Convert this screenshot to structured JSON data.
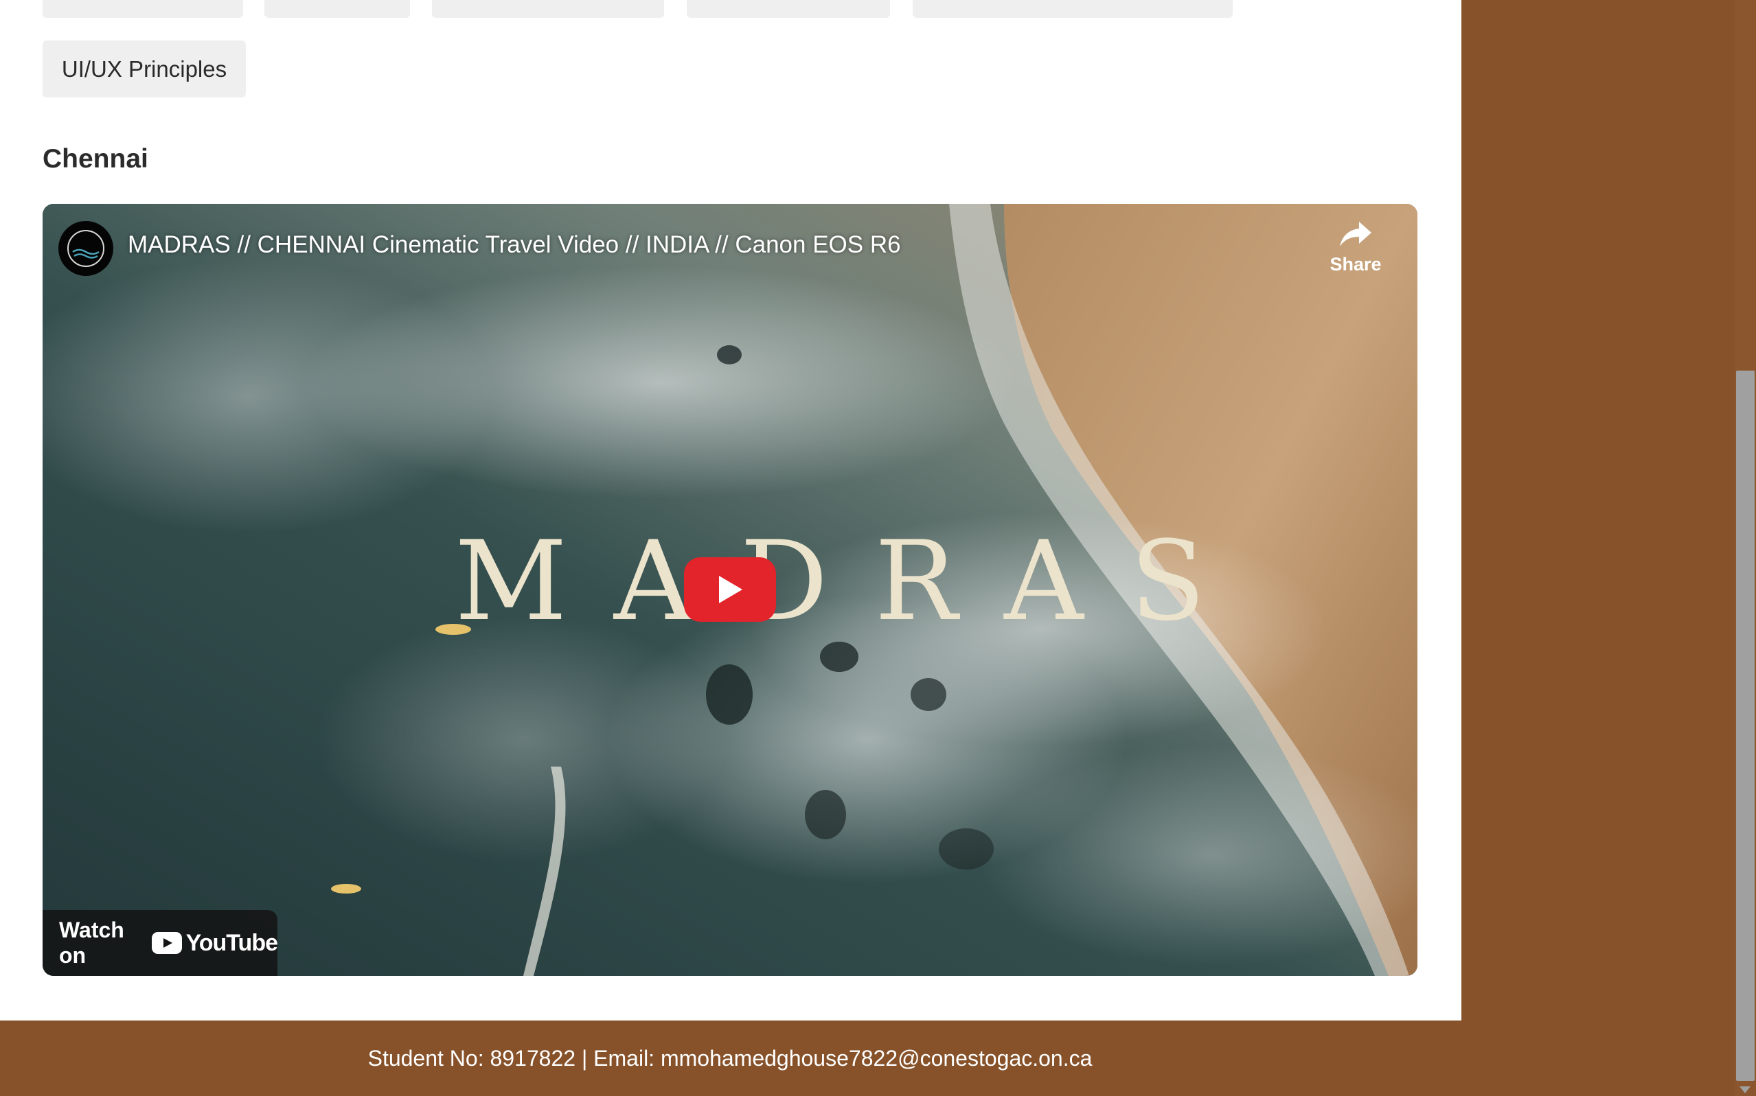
{
  "tags": {
    "row1": [
      "",
      "",
      "",
      "",
      ""
    ],
    "ui_ux": "UI/UX Principles"
  },
  "section": {
    "heading": "Chennai"
  },
  "video": {
    "title": "MADRAS // CHENNAI Cinematic Travel Video // INDIA // Canon EOS R6",
    "share_label": "Share",
    "overlay_text": "MADRAS",
    "watch_on_label": "Watch on",
    "brand": "YouTube"
  },
  "footer": {
    "text": "Student No: 8917822 | Email: mmohamedghouse7822@conestogac.on.ca"
  },
  "colors": {
    "background": "#87522a",
    "page": "#ffffff",
    "tag": "#efefef",
    "play_button": "#e3242b"
  }
}
